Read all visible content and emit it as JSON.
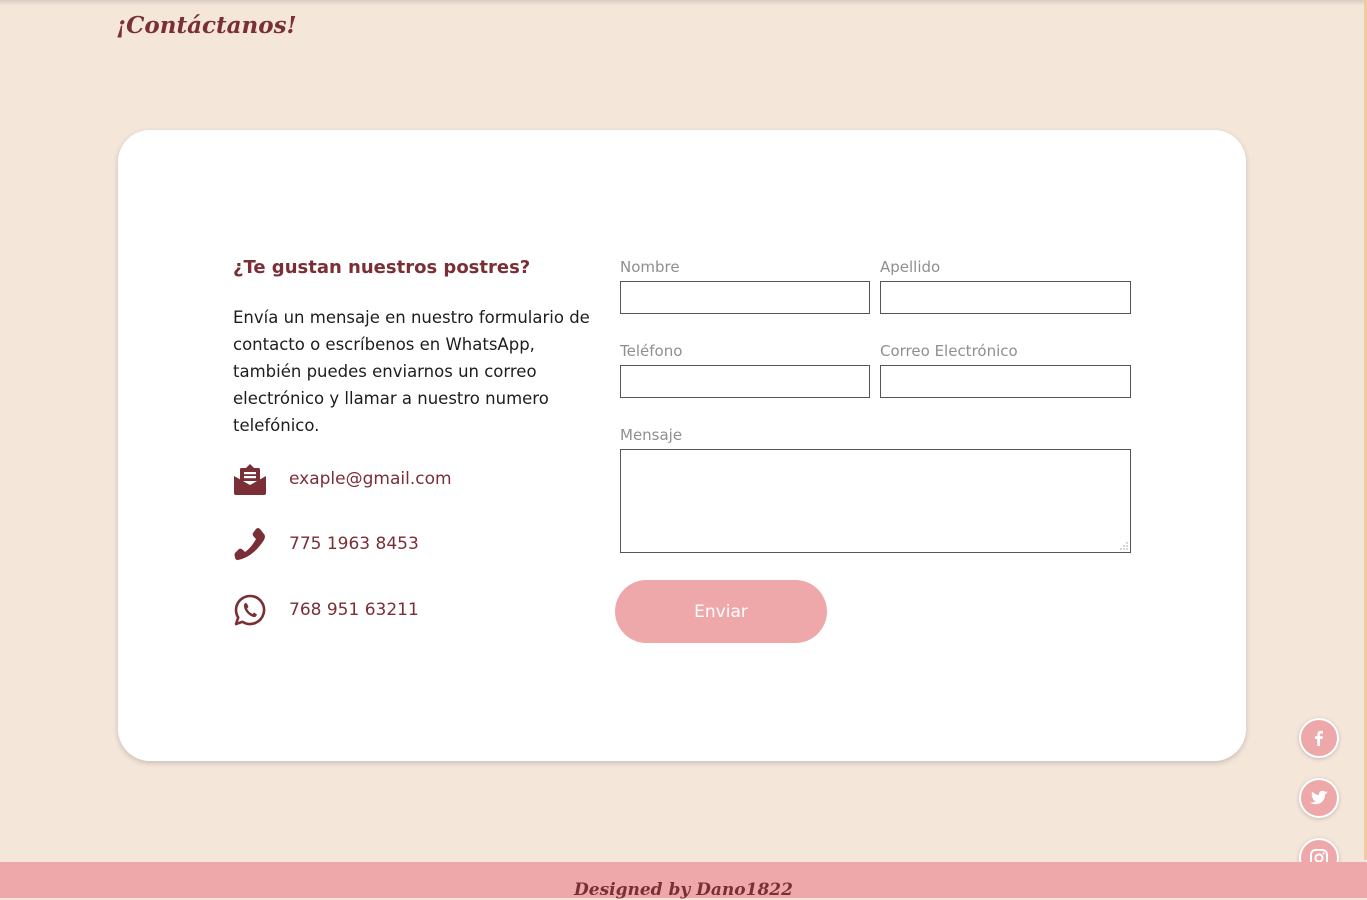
{
  "header": {
    "title": "¡Contáctanos!"
  },
  "info": {
    "heading": "¿Te gustan nuestros postres?",
    "text": "Envía un mensaje en nuestro formulario de contacto o escríbenos en WhatsApp, también puedes enviarnos un correo electrónico y llamar a nuestro numero telefónico.",
    "email": "exaple@gmail.com",
    "phone": "775 1963 8453",
    "whatsapp": "768 951 63211"
  },
  "form": {
    "nombre_label": "Nombre",
    "apellido_label": "Apellido",
    "telefono_label": "Teléfono",
    "correo_label": "Correo Electrónico",
    "mensaje_label": "Mensaje",
    "submit_label": "Enviar"
  },
  "social": [
    "facebook-icon",
    "twitter-icon",
    "instagram-icon"
  ],
  "footer": {
    "text": "Designed by Dano1822"
  },
  "colors": {
    "background": "#f5e6da",
    "accent": "#efa8aa",
    "brand": "#7a2f36"
  }
}
